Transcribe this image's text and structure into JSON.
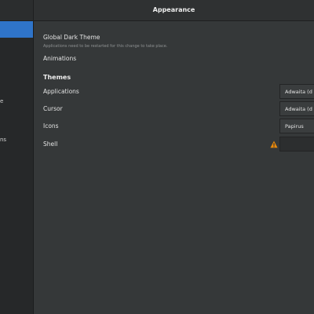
{
  "window": {
    "title": "Appearance"
  },
  "sidebar": {
    "items": [
      {
        "label": ""
      },
      {
        "label": "e"
      },
      {
        "label": "ns"
      }
    ]
  },
  "settings": {
    "global_dark_theme": {
      "label": "Global Dark Theme",
      "sublabel": "Applications need to be restarted for this change to take place."
    },
    "animations": {
      "label": "Animations"
    }
  },
  "themes": {
    "heading": "Themes",
    "rows": [
      {
        "label": "Applications",
        "value": "Adwaita (d"
      },
      {
        "label": "Cursor",
        "value": "Adwaita (d"
      },
      {
        "label": "Icons",
        "value": "Papirus"
      },
      {
        "label": "Shell",
        "value": ""
      }
    ]
  },
  "colors": {
    "accent": "#2f74c9",
    "warning": "#e8890c"
  },
  "icons": {
    "shell_warning": "warning-icon"
  }
}
